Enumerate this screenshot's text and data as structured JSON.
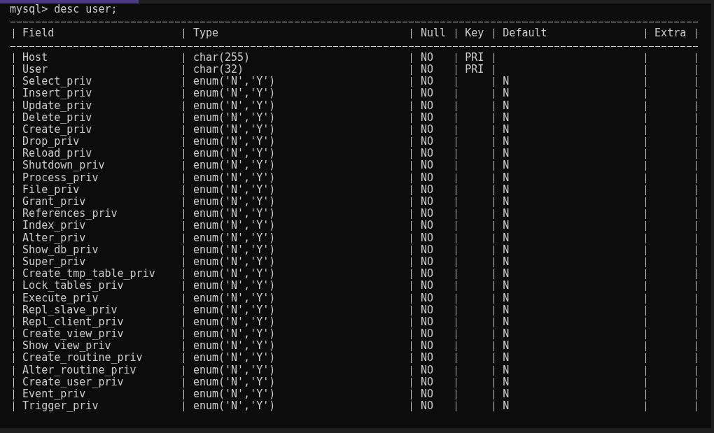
{
  "prompt": "mysql> desc user;",
  "columns": [
    "Field",
    "Type",
    "Null",
    "Key",
    "Default",
    "Extra"
  ],
  "rows": [
    {
      "field": "Host",
      "type": "char(255)",
      "null": "NO",
      "key": "PRI"
    },
    {
      "field": "User",
      "type": "char(32)",
      "null": "NO",
      "key": "PRI"
    },
    {
      "field": "Select_priv",
      "type": "enum('N','Y')",
      "null": "NO",
      "default": "N"
    },
    {
      "field": "Insert_priv",
      "type": "enum('N','Y')",
      "null": "NO",
      "default": "N"
    },
    {
      "field": "Update_priv",
      "type": "enum('N','Y')",
      "null": "NO",
      "default": "N"
    },
    {
      "field": "Delete_priv",
      "type": "enum('N','Y')",
      "null": "NO",
      "default": "N"
    },
    {
      "field": "Create_priv",
      "type": "enum('N','Y')",
      "null": "NO",
      "default": "N"
    },
    {
      "field": "Drop_priv",
      "type": "enum('N','Y')",
      "null": "NO",
      "default": "N"
    },
    {
      "field": "Reload_priv",
      "type": "enum('N','Y')",
      "null": "NO",
      "default": "N"
    },
    {
      "field": "Shutdown_priv",
      "type": "enum('N','Y')",
      "null": "NO",
      "default": "N"
    },
    {
      "field": "Process_priv",
      "type": "enum('N','Y')",
      "null": "NO",
      "default": "N"
    },
    {
      "field": "File_priv",
      "type": "enum('N','Y')",
      "null": "NO",
      "default": "N"
    },
    {
      "field": "Grant_priv",
      "type": "enum('N','Y')",
      "null": "NO",
      "default": "N"
    },
    {
      "field": "References_priv",
      "type": "enum('N','Y')",
      "null": "NO",
      "default": "N"
    },
    {
      "field": "Index_priv",
      "type": "enum('N','Y')",
      "null": "NO",
      "default": "N"
    },
    {
      "field": "Alter_priv",
      "type": "enum('N','Y')",
      "null": "NO",
      "default": "N"
    },
    {
      "field": "Show_db_priv",
      "type": "enum('N','Y')",
      "null": "NO",
      "default": "N"
    },
    {
      "field": "Super_priv",
      "type": "enum('N','Y')",
      "null": "NO",
      "default": "N"
    },
    {
      "field": "Create_tmp_table_priv",
      "type": "enum('N','Y')",
      "null": "NO",
      "default": "N"
    },
    {
      "field": "Lock_tables_priv",
      "type": "enum('N','Y')",
      "null": "NO",
      "default": "N"
    },
    {
      "field": "Execute_priv",
      "type": "enum('N','Y')",
      "null": "NO",
      "default": "N"
    },
    {
      "field": "Repl_slave_priv",
      "type": "enum('N','Y')",
      "null": "NO",
      "default": "N"
    },
    {
      "field": "Repl_client_priv",
      "type": "enum('N','Y')",
      "null": "NO",
      "default": "N"
    },
    {
      "field": "Create_view_priv",
      "type": "enum('N','Y')",
      "null": "NO",
      "default": "N"
    },
    {
      "field": "Show_view_priv",
      "type": "enum('N','Y')",
      "null": "NO",
      "default": "N"
    },
    {
      "field": "Create_routine_priv",
      "type": "enum('N','Y')",
      "null": "NO",
      "default": "N"
    },
    {
      "field": "Alter_routine_priv",
      "type": "enum('N','Y')",
      "null": "NO",
      "default": "N"
    },
    {
      "field": "Create_user_priv",
      "type": "enum('N','Y')",
      "null": "NO",
      "default": "N"
    },
    {
      "field": "Event_priv",
      "type": "enum('N','Y')",
      "null": "NO",
      "default": "N"
    },
    {
      "field": "Trigger_priv",
      "type": "enum('N','Y')",
      "null": "NO",
      "default": "N"
    }
  ]
}
